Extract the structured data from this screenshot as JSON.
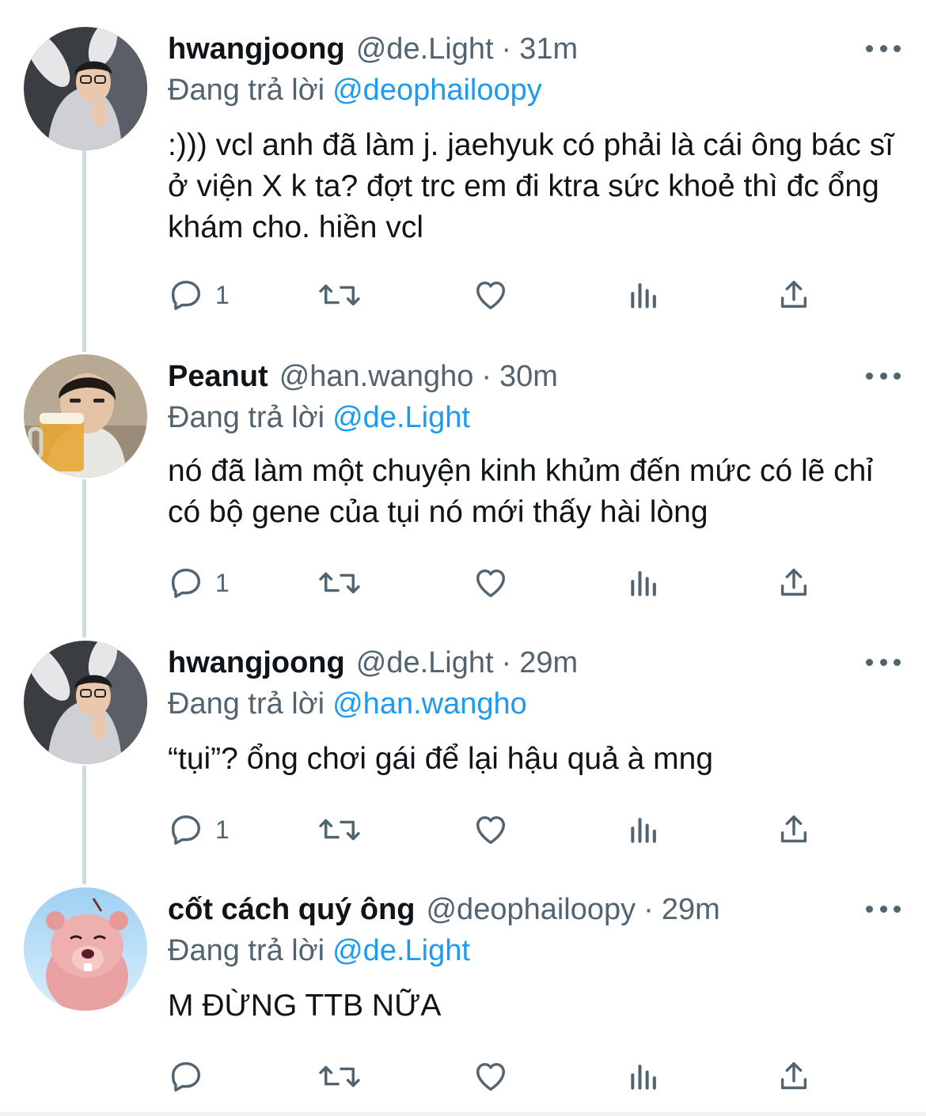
{
  "tweets": [
    {
      "name": "hwangjoong",
      "handle": "@de.Light",
      "separator": "·",
      "time": "31m",
      "replying_label": "Đang trả lời",
      "replying_to": "@deophailoopy",
      "text": ":))) vcl anh đã làm j. jaehyuk có phải là cái ông bác sĩ ở viện X k ta? đợt trc em đi ktra sức khoẻ thì đc ổng khám cho. hiền vcl",
      "reply_count": "1",
      "avatar": "hooded-guy-bunny-ears"
    },
    {
      "name": "Peanut",
      "handle": "@han.wangho",
      "separator": "·",
      "time": "30m",
      "replying_label": "Đang trả lời",
      "replying_to": "@de.Light",
      "text": "nó đã làm một chuyện kinh khủm đến mức có lẽ chỉ có bộ gene của tụi nó mới thấy hài lòng",
      "reply_count": "1",
      "avatar": "guy-with-beer-mug"
    },
    {
      "name": "hwangjoong",
      "handle": "@de.Light",
      "separator": "·",
      "time": "29m",
      "replying_label": "Đang trả lời",
      "replying_to": "@han.wangho",
      "text": "“tụi”? ổng chơi gái để lại hậu quả à mng",
      "reply_count": "1",
      "avatar": "hooded-guy-bunny-ears"
    },
    {
      "name": "cốt cách quý ông",
      "handle": "@deophailoopy",
      "separator": "·",
      "time": "29m",
      "replying_label": "Đang trả lời",
      "replying_to": "@de.Light",
      "text": "M ĐỪNG TTB NỮA",
      "reply_count": "",
      "avatar": "pink-beaver-loopy"
    }
  ],
  "colors": {
    "text": "#0f1419",
    "secondary": "#536471",
    "link": "#1d9bf0",
    "thread_line": "#cfd9de"
  },
  "icons": [
    "reply-icon",
    "retweet-icon",
    "like-icon",
    "views-icon",
    "share-icon",
    "more-icon"
  ]
}
